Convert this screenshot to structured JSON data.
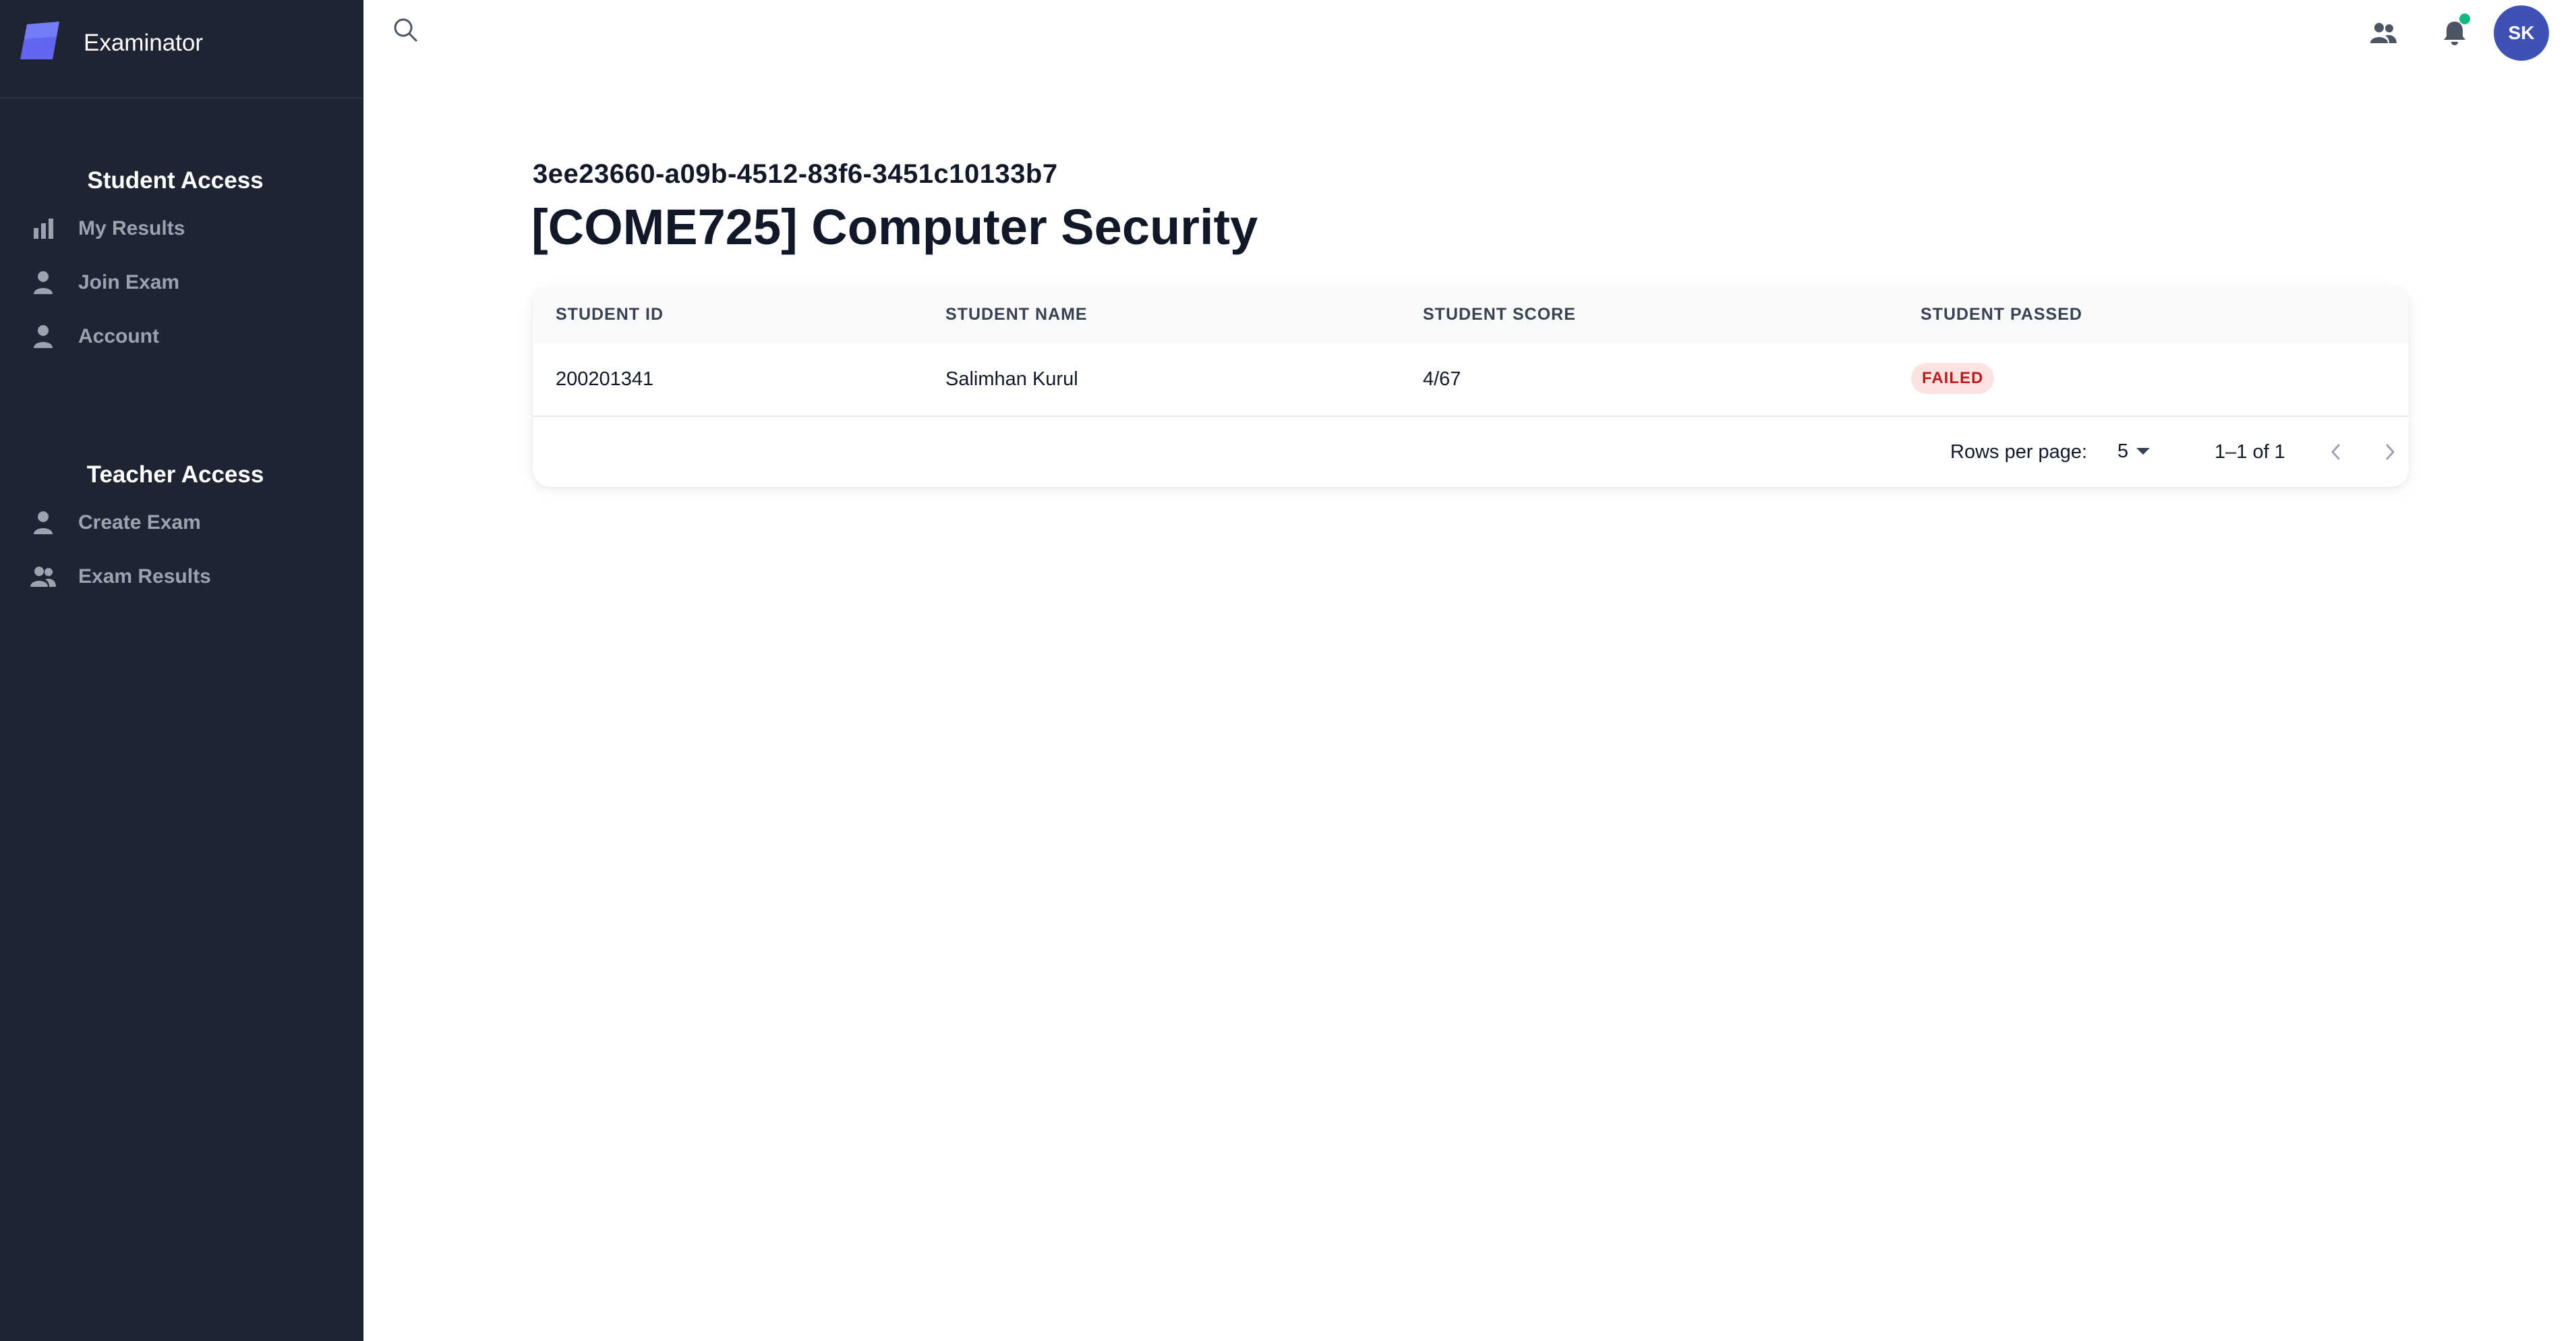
{
  "app": {
    "name": "Examinator"
  },
  "sidebar": {
    "student_section": {
      "title": "Student Access",
      "items": [
        {
          "label": "My Results",
          "icon": "bar-chart-icon"
        },
        {
          "label": "Join Exam",
          "icon": "user-icon"
        },
        {
          "label": "Account",
          "icon": "user-icon"
        }
      ]
    },
    "teacher_section": {
      "title": "Teacher Access",
      "items": [
        {
          "label": "Create Exam",
          "icon": "user-icon"
        },
        {
          "label": "Exam Results",
          "icon": "users-icon"
        }
      ]
    }
  },
  "topbar": {
    "search_icon": "search-icon",
    "contacts_icon": "users-icon",
    "notifications_icon": "bell-icon",
    "avatar_initials": "SK",
    "colors": {
      "avatar": "#3f51b5",
      "notification_dot": "#10b981"
    }
  },
  "main": {
    "exam_id": "3ee23660-a09b-4512-83f6-3451c10133b7",
    "exam_title": "[COME725] Computer Security",
    "table": {
      "columns": [
        "STUDENT ID",
        "STUDENT NAME",
        "STUDENT SCORE",
        "STUDENT PASSED"
      ],
      "rows": [
        {
          "student_id": "200201341",
          "student_name": "Salimhan Kurul",
          "student_score": "4/67",
          "student_passed": "FAILED"
        }
      ],
      "pagination": {
        "rows_per_page_label": "Rows per page:",
        "rows_per_page": "5",
        "range": "1–1 of 1"
      }
    }
  },
  "colors": {
    "sidebar_bg": "#1f2432",
    "failed_badge_bg": "#fde2e2",
    "failed_badge_text": "#b91c1c"
  }
}
